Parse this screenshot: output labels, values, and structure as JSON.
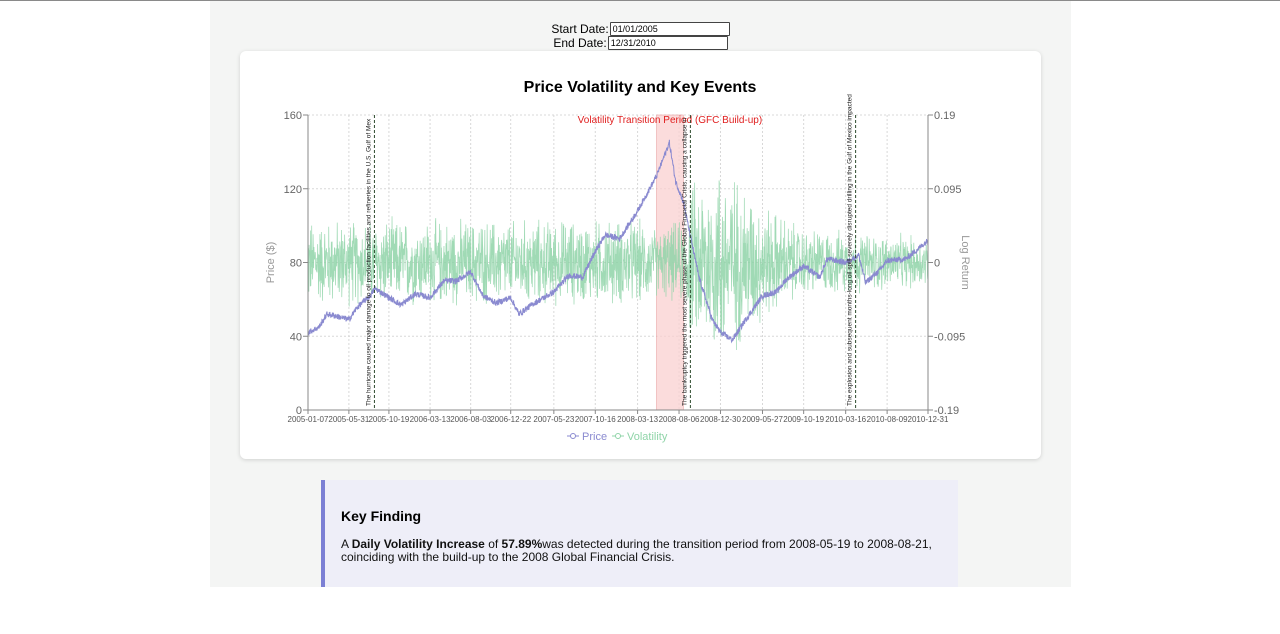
{
  "controls": {
    "start_label": "Start Date:",
    "start_value": "01/01/2005",
    "end_label": "End Date:",
    "end_value": "12/31/2010"
  },
  "chart_data": {
    "type": "line",
    "title": "Price Volatility and Key Events",
    "ylabel_left": "Price ($)",
    "ylabel_right": "Log Return",
    "y_left_ticks": [
      0,
      40,
      80,
      120,
      160
    ],
    "y_right_ticks": [
      "-0.19",
      "-0.095",
      "0",
      "0.095",
      "0.19"
    ],
    "ylim_left": [
      0,
      160
    ],
    "ylim_right": [
      -0.19,
      0.19
    ],
    "x_ticks": [
      "2005-01-07",
      "2005-05-31",
      "2005-10-19",
      "2006-03-13",
      "2006-08-03",
      "2006-12-22",
      "2007-05-23",
      "2007-10-16",
      "2008-03-13",
      "2008-08-06",
      "2008-12-30",
      "2009-05-27",
      "2009-10-19",
      "2010-03-16",
      "2010-08-09",
      "2010-12-31"
    ],
    "grid": true,
    "legend": [
      "Price",
      "Volatility"
    ],
    "legend_position": "bottom-center",
    "colors": {
      "price": "#8a8ad0",
      "volatility": "#8fd4a8",
      "highlight": "#f9d0d0",
      "highlight_label": "#e01e1e"
    },
    "highlight": {
      "start": "2008-05-19",
      "end": "2008-08-21",
      "label": "Volatility Transition Period (GFC Build-up)"
    },
    "events": [
      {
        "date": "2005-08-29",
        "text": "The hurricane caused major damage to oil production facilities and refineries in the U.S. Gulf of Mex"
      },
      {
        "date": "2008-09-15",
        "text": "The bankruptcy triggered the most severe phase of the Global Financial Crisis, causing a collapse in"
      },
      {
        "date": "2010-04-20",
        "text": "The explosion and subsequent months-long oil spill severely disrupted drilling in the Gulf of Mexico impacted"
      }
    ],
    "price_series": [
      [
        "2005-01-07",
        42
      ],
      [
        "2005-02-15",
        45
      ],
      [
        "2005-03-15",
        52
      ],
      [
        "2005-04-15",
        51
      ],
      [
        "2005-05-31",
        49
      ],
      [
        "2005-07-01",
        56
      ],
      [
        "2005-08-15",
        62
      ],
      [
        "2005-08-30",
        66
      ],
      [
        "2005-10-19",
        61
      ],
      [
        "2005-12-01",
        57
      ],
      [
        "2006-01-20",
        63
      ],
      [
        "2006-03-13",
        61
      ],
      [
        "2006-05-01",
        70
      ],
      [
        "2006-06-15",
        70
      ],
      [
        "2006-08-03",
        75
      ],
      [
        "2006-09-15",
        62
      ],
      [
        "2006-11-01",
        58
      ],
      [
        "2006-12-22",
        61
      ],
      [
        "2007-01-20",
        52
      ],
      [
        "2007-03-15",
        58
      ],
      [
        "2007-05-23",
        64
      ],
      [
        "2007-07-15",
        73
      ],
      [
        "2007-09-01",
        72
      ],
      [
        "2007-10-16",
        86
      ],
      [
        "2007-11-20",
        95
      ],
      [
        "2008-01-10",
        93
      ],
      [
        "2008-03-13",
        108
      ],
      [
        "2008-05-19",
        127
      ],
      [
        "2008-07-03",
        145
      ],
      [
        "2008-07-25",
        124
      ],
      [
        "2008-08-21",
        113
      ],
      [
        "2008-10-15",
        72
      ],
      [
        "2008-12-01",
        49
      ],
      [
        "2008-12-30",
        42
      ],
      [
        "2009-02-10",
        38
      ],
      [
        "2009-03-20",
        47
      ],
      [
        "2009-05-27",
        62
      ],
      [
        "2009-07-15",
        64
      ],
      [
        "2009-08-20",
        71
      ],
      [
        "2009-10-19",
        78
      ],
      [
        "2009-12-15",
        72
      ],
      [
        "2010-01-10",
        82
      ],
      [
        "2010-03-16",
        80
      ],
      [
        "2010-05-01",
        84
      ],
      [
        "2010-05-25",
        69
      ],
      [
        "2010-07-15",
        76
      ],
      [
        "2010-08-09",
        81
      ],
      [
        "2010-10-15",
        82
      ],
      [
        "2010-12-31",
        92
      ]
    ],
    "volatility_amplitude": [
      [
        "2005-01-07",
        0.05
      ],
      [
        "2008-03-13",
        0.05
      ],
      [
        "2008-05-19",
        0.04
      ],
      [
        "2008-08-21",
        0.05
      ],
      [
        "2008-09-15",
        0.09
      ],
      [
        "2008-12-30",
        0.12
      ],
      [
        "2009-05-27",
        0.07
      ],
      [
        "2009-10-19",
        0.04
      ],
      [
        "2010-12-31",
        0.03
      ]
    ]
  },
  "finding": {
    "title": "Key Finding",
    "text_a": "A ",
    "bold_metric": "Daily Volatility Increase",
    "text_of": " of ",
    "bold_value": "57.89%",
    "text_rest": "was detected during the transition period from 2008-05-19 to 2008-08-21, coinciding with the build-up to the 2008 Global Financial Crisis."
  }
}
